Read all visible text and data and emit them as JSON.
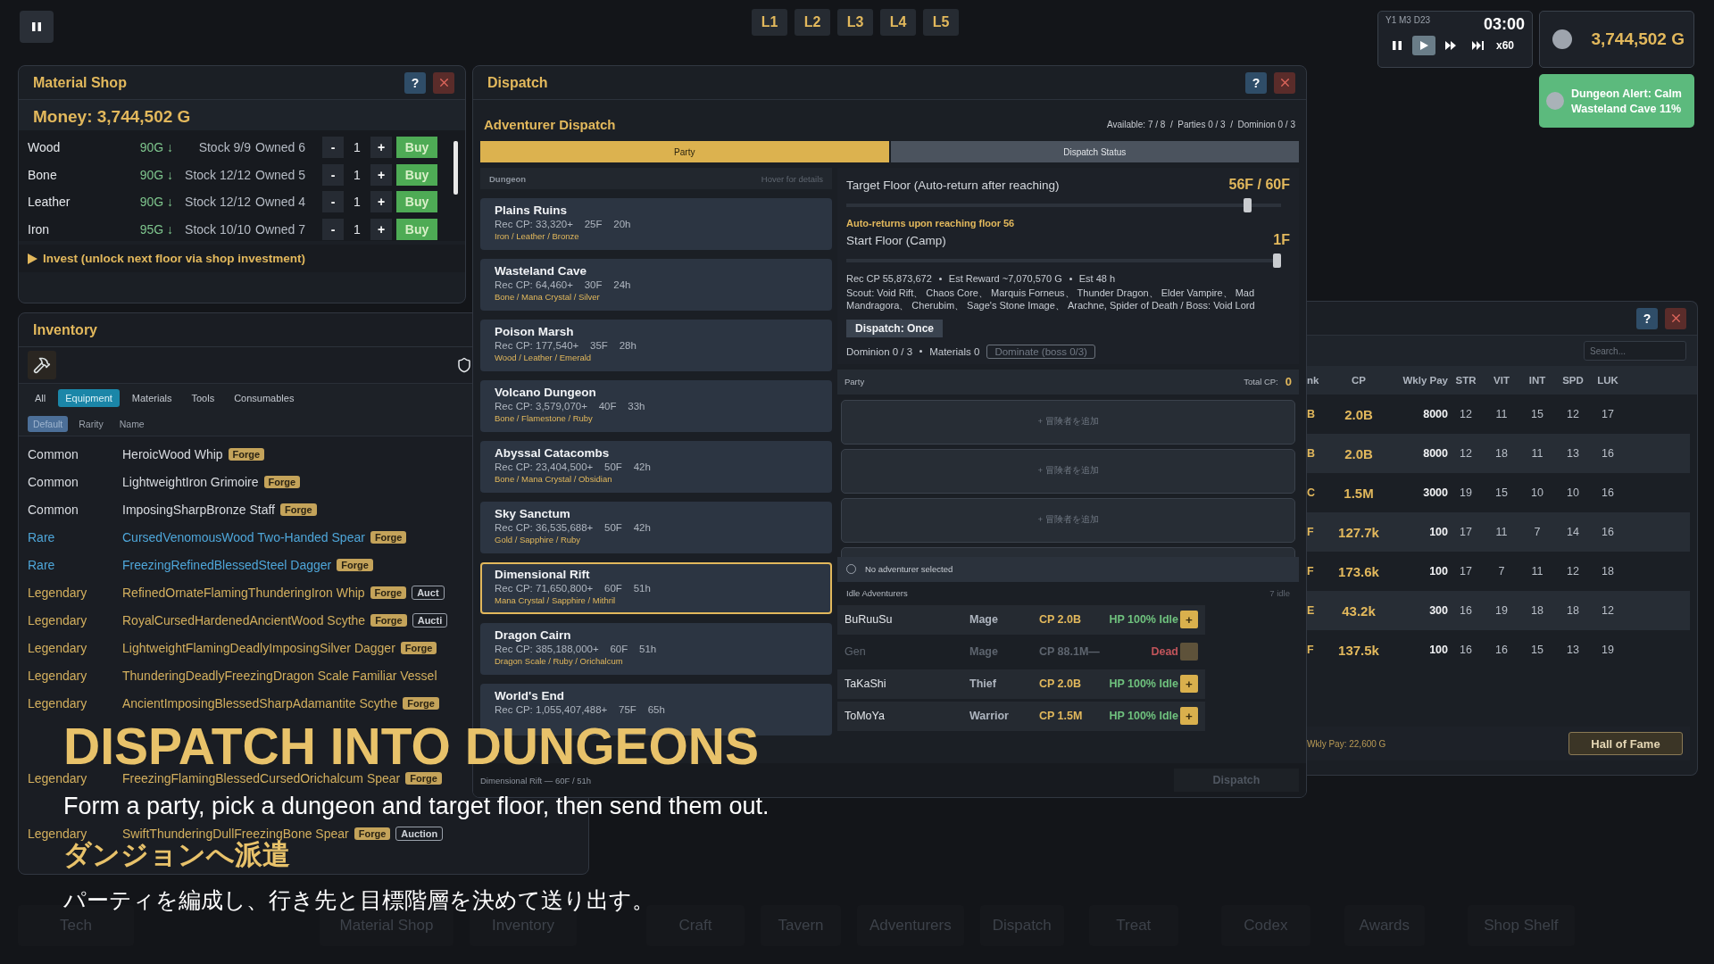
{
  "hud": {
    "floor_tabs": [
      {
        "label": "L1"
      },
      {
        "label": "L2"
      },
      {
        "label": "L3"
      },
      {
        "label": "L4"
      },
      {
        "label": "L5"
      }
    ],
    "clock": {
      "date": "Y1 M3 D23",
      "time": "03:00",
      "speed": "x60",
      "controls": [
        {
          "kind": "pause",
          "selected": false
        },
        {
          "kind": "play",
          "selected": true
        },
        {
          "kind": "fast",
          "selected": false
        },
        {
          "kind": "skip",
          "selected": false
        }
      ]
    },
    "money": "3,744,502 G",
    "alert": {
      "title": "Dungeon Alert: Calm",
      "detail": "Wasteland Cave  11%"
    }
  },
  "material_shop": {
    "title": "Material Shop",
    "help": "?",
    "money": "Money: 3,744,502 G",
    "rows": [
      {
        "name": "Wood",
        "price": "90G ↓",
        "stock": "Stock 9/9",
        "owned": "Owned 6",
        "dec": "-",
        "qty": "1",
        "inc": "+",
        "buy": "Buy"
      },
      {
        "name": "Bone",
        "price": "90G ↓",
        "stock": "Stock 12/12",
        "owned": "Owned 5",
        "dec": "-",
        "qty": "1",
        "inc": "+",
        "buy": "Buy"
      },
      {
        "name": "Leather",
        "price": "90G ↓",
        "stock": "Stock 12/12",
        "owned": "Owned 4",
        "dec": "-",
        "qty": "1",
        "inc": "+",
        "buy": "Buy"
      },
      {
        "name": "Iron",
        "price": "95G ↓",
        "stock": "Stock 10/10",
        "owned": "Owned 7",
        "dec": "-",
        "qty": "1",
        "inc": "+",
        "buy": "Buy"
      }
    ],
    "invest": "Invest (unlock next floor via shop investment)"
  },
  "inventory": {
    "title": "Inventory",
    "filters": [
      {
        "label": "All",
        "selected": false
      },
      {
        "label": "Equipment",
        "selected": true
      },
      {
        "label": "Materials",
        "selected": false
      },
      {
        "label": "Tools",
        "selected": false
      },
      {
        "label": "Consumables",
        "selected": false
      }
    ],
    "sorts": [
      {
        "label": "Default",
        "selected": true
      },
      {
        "label": "Rarity",
        "selected": false
      },
      {
        "label": "Name",
        "selected": false
      }
    ],
    "items": [
      {
        "rarity": "Common",
        "kind": "common",
        "name": "HeroicWood Whip",
        "tags": [
          {
            "label": "Forge",
            "kind": "forge"
          }
        ]
      },
      {
        "rarity": "Common",
        "kind": "common",
        "name": "LightweightIron Grimoire",
        "tags": [
          {
            "label": "Forge",
            "kind": "forge"
          }
        ]
      },
      {
        "rarity": "Common",
        "kind": "common",
        "name": "ImposingSharpBronze Staff",
        "tags": [
          {
            "label": "Forge",
            "kind": "forge"
          }
        ]
      },
      {
        "rarity": "Rare",
        "kind": "rare",
        "name": "CursedVenomousWood Two-Handed Spear",
        "tags": [
          {
            "label": "Forge",
            "kind": "forge"
          }
        ]
      },
      {
        "rarity": "Rare",
        "kind": "rare",
        "name": "FreezingRefinedBlessedSteel Dagger",
        "tags": [
          {
            "label": "Forge",
            "kind": "forge"
          }
        ]
      },
      {
        "rarity": "Legendary",
        "kind": "legendary",
        "name": "RefinedOrnateFlamingThunderingIron Whip",
        "tags": [
          {
            "label": "Forge",
            "kind": "forge"
          },
          {
            "label": "Auct",
            "kind": "auction"
          }
        ]
      },
      {
        "rarity": "Legendary",
        "kind": "legendary",
        "name": "RoyalCursedHardenedAncientWood Scythe",
        "tags": [
          {
            "label": "Forge",
            "kind": "forge"
          },
          {
            "label": "Aucti",
            "kind": "auction"
          }
        ]
      },
      {
        "rarity": "Legendary",
        "kind": "legendary",
        "name": "LightweightFlamingDeadlyImposingSilver Dagger",
        "tags": [
          {
            "label": "Forge",
            "kind": "forge"
          }
        ]
      },
      {
        "rarity": "Legendary",
        "kind": "legendary",
        "name": "ThunderingDeadlyFreezingDragon Scale Familiar Vessel"
      },
      {
        "rarity": "Legendary",
        "kind": "legendary",
        "name": "AncientImposingBlessedSharpAdamantite Scythe",
        "tags": [
          {
            "label": "Forge",
            "kind": "forge"
          }
        ]
      }
    ],
    "lower_items": [
      {
        "rarity": "Legendary",
        "kind": "legendary",
        "name": "FreezingFlamingBlessedCursedOrichalcum Spear",
        "tags": [
          {
            "label": "Forge",
            "kind": "forge"
          }
        ]
      },
      {
        "rarity": "Legendary",
        "kind": "legendary",
        "name": "SwiftThunderingDullFreezingBone Spear",
        "tags": [
          {
            "label": "Forge",
            "kind": "forge"
          },
          {
            "label": "Auction",
            "kind": "auction"
          }
        ]
      }
    ]
  },
  "dispatch": {
    "title": "Dispatch",
    "help": "?",
    "heading": "Adventurer Dispatch",
    "stats": "Available: 7 / 8  /  Parties 0 / 3  /  Dominion 0 / 3",
    "tabs": [
      {
        "label": "Party",
        "selected": true
      },
      {
        "label": "Dispatch Status",
        "selected": false
      }
    ],
    "dungeon_header": "Dungeon",
    "dungeon_hint": "Hover for details",
    "dungeons": [
      {
        "name": "Plains Ruins",
        "cp": "Rec CP: 33,320+",
        "floors": "25F",
        "time": "20h",
        "materials": "Iron / Leather / Bronze",
        "selected": false
      },
      {
        "name": "Wasteland Cave",
        "cp": "Rec CP: 64,460+",
        "floors": "30F",
        "time": "24h",
        "materials": "Bone / Mana Crystal / Silver",
        "selected": false
      },
      {
        "name": "Poison Marsh",
        "cp": "Rec CP: 177,540+",
        "floors": "35F",
        "time": "28h",
        "materials": "Wood / Leather / Emerald",
        "selected": false
      },
      {
        "name": "Volcano Dungeon",
        "cp": "Rec CP: 3,579,070+",
        "floors": "40F",
        "time": "33h",
        "materials": "Bone / Flamestone / Ruby",
        "selected": false
      },
      {
        "name": "Abyssal Catacombs",
        "cp": "Rec CP: 23,404,500+",
        "floors": "50F",
        "time": "42h",
        "materials": "Bone / Mana Crystal / Obsidian",
        "selected": false
      },
      {
        "name": "Sky Sanctum",
        "cp": "Rec CP: 36,535,688+",
        "floors": "50F",
        "time": "42h",
        "materials": "Gold / Sapphire / Ruby",
        "selected": false
      },
      {
        "name": "Dimensional Rift",
        "cp": "Rec CP: 71,650,800+",
        "floors": "60F",
        "time": "51h",
        "materials": "Mana Crystal / Sapphire / Mithril",
        "selected": true
      },
      {
        "name": "Dragon Cairn",
        "cp": "Rec CP: 385,188,000+",
        "floors": "60F",
        "time": "51h",
        "materials": "Dragon Scale / Ruby / Orichalcum",
        "selected": false
      },
      {
        "name": "World's End",
        "cp": "Rec CP: 1,055,407,488+",
        "floors": "75F",
        "time": "65h",
        "selected": false
      }
    ],
    "target_label": "Target Floor (Auto-return after reaching)",
    "target_value": "56F / 60F",
    "target_slider": {
      "level": 0.93
    },
    "auto_return": "Auto-returns upon reaching floor 56",
    "start_label": "Start Floor (Camp)",
    "start_value": "1F",
    "start_slider": {
      "level": 1
    },
    "summary": [
      "Rec CP 55,873,672",
      "Est Reward ~7,070,570 G",
      "Est 48 h"
    ],
    "scout": "Scout: Void Rift、 Chaos Core、 Marquis Forneus、 Thunder Dragon、 Elder Vampire、 Mad Mandragora、 Cherubim、 Sage's Stone Image、 Arachne, Spider of Death / Boss: Void Lord",
    "mode_button": "Dispatch: Once",
    "dominion": [
      "Dominion 0 / 3",
      "Materials 0"
    ],
    "dominate_button": "Dominate (boss 0/3)",
    "party_label": "Party",
    "total_label": "Total CP:",
    "total_value": "0",
    "slots": [
      "+ 冒険者を追加",
      "+ 冒険者を追加",
      "+ 冒険者を追加"
    ],
    "no_selection": "No adventurer selected",
    "idle_label": "Idle Adventurers",
    "idle_count": "7 idle",
    "adventurers": [
      {
        "name": "BuRuuSu",
        "class": "Mage",
        "cp": "CP 2.0B",
        "status": "HP 100% Idle",
        "kind": "idle",
        "add": "+"
      },
      {
        "name": "Gen",
        "class": "Mage",
        "cp": "CP 88.1M—",
        "status": "Dead",
        "kind": "dead"
      },
      {
        "name": "TaKaShi",
        "class": "Thief",
        "cp": "CP 2.0B",
        "status": "HP 100% Idle",
        "kind": "idle",
        "add": "+"
      },
      {
        "name": "ToMoYa",
        "class": "Warrior",
        "cp": "CP 1.5M",
        "status": "HP 100% Idle",
        "kind": "idle",
        "add": "+"
      }
    ],
    "footer": "Dimensional Rift — 60F / 51h",
    "dispatch_button": "Dispatch"
  },
  "adventurers": {
    "help": "?",
    "search_placeholder": "Search...",
    "columns": [
      "nk",
      "CP",
      "Wkly Pay",
      "STR",
      "VIT",
      "INT",
      "SPD",
      "LUK"
    ],
    "rows": [
      [
        "B",
        "2.0B",
        "8000",
        "12",
        "11",
        "15",
        "12",
        "17"
      ],
      [
        "B",
        "2.0B",
        "8000",
        "12",
        "18",
        "11",
        "13",
        "16"
      ],
      [
        "C",
        "1.5M",
        "3000",
        "19",
        "15",
        "10",
        "10",
        "16"
      ],
      [
        "F",
        "127.7k",
        "100",
        "17",
        "11",
        "7",
        "14",
        "16"
      ],
      [
        "F",
        "173.6k",
        "100",
        "17",
        "7",
        "11",
        "12",
        "18"
      ],
      [
        "E",
        "43.2k",
        "300",
        "16",
        "19",
        "18",
        "18",
        "12"
      ],
      [
        "F",
        "137.5k",
        "100",
        "16",
        "16",
        "15",
        "13",
        "19"
      ]
    ],
    "pay_total": "Wkly Pay: 22,600 G",
    "hall_button": "Hall of Fame"
  },
  "caption": {
    "title": "DISPATCH INTO DUNGEONS",
    "subtitle": "Form a party, pick a dungeon and target floor, then send them out.",
    "title_ja": "ダンジョンへ派遣",
    "subtitle_ja": "パーティを編成し、行き先と目標階層を決めて送り出す。"
  },
  "nav": [
    "Tech",
    "Material Shop",
    "Inventory",
    "Craft",
    "Tavern",
    "Adventurers",
    "Dispatch",
    "Treat",
    "Codex",
    "Awards",
    "Shop Shelf"
  ]
}
